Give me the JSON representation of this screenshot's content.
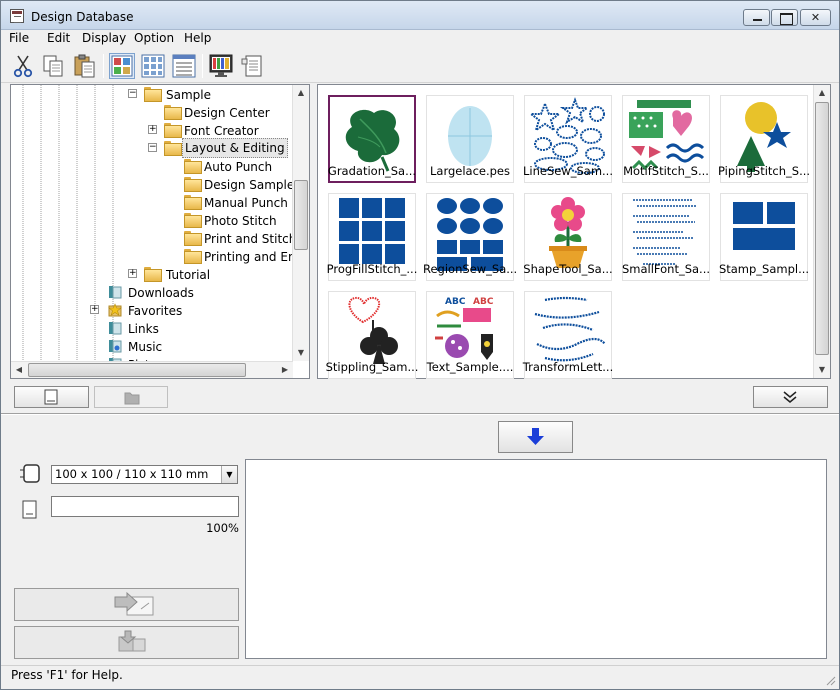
{
  "window": {
    "title": "Design Database"
  },
  "menu": [
    "File",
    "Edit",
    "Display",
    "Option",
    "Help"
  ],
  "toolbar": {
    "buttons": [
      "cut-icon",
      "copy-icon",
      "paste-icon",
      "large-thumbnails-icon",
      "small-thumbnails-icon",
      "details-view-icon",
      "preview-monitor-icon",
      "properties-icon"
    ]
  },
  "tree": {
    "items": [
      {
        "label": "Sample",
        "level": 0,
        "expanded": true
      },
      {
        "label": "Design Center",
        "level": 1
      },
      {
        "label": "Font Creator",
        "level": 1,
        "expandable": true
      },
      {
        "label": "Layout & Editing",
        "level": 1,
        "expanded": true,
        "selected": true
      },
      {
        "label": "Auto Punch",
        "level": 2
      },
      {
        "label": "Design Sample",
        "level": 2
      },
      {
        "label": "Manual Punch",
        "level": 2
      },
      {
        "label": "Photo Stitch",
        "level": 2
      },
      {
        "label": "Print and Stitch",
        "level": 2
      },
      {
        "label": "Printing and Emb",
        "level": 2
      },
      {
        "label": "Tutorial",
        "level": 0,
        "expandable": true
      },
      {
        "label": "Downloads",
        "level": -1
      },
      {
        "label": "Favorites",
        "level": -1,
        "expandable": true
      },
      {
        "label": "Links",
        "level": -1
      },
      {
        "label": "Music",
        "level": -1
      },
      {
        "label": "Pictures",
        "level": -1
      }
    ]
  },
  "files": [
    {
      "label": "Gradation_Sa...",
      "selected": true
    },
    {
      "label": "Largelace.pes"
    },
    {
      "label": "LineSew_Sam..."
    },
    {
      "label": "MotifStitch_S..."
    },
    {
      "label": "PipingStitch_S..."
    },
    {
      "label": "ProgFillStitch_..."
    },
    {
      "label": "RegionSew_Sa..."
    },
    {
      "label": "ShapeTool_Sa..."
    },
    {
      "label": "SmallFont_Sa..."
    },
    {
      "label": "Stamp_Sampl..."
    },
    {
      "label": "Stippling_Sam..."
    },
    {
      "label": "Text_Sample...."
    },
    {
      "label": "TransformLett..."
    }
  ],
  "hoop": {
    "selected": "100 x 100 / 110 x 110 mm"
  },
  "design_name": {
    "value": ""
  },
  "progress": {
    "text": "100%"
  },
  "status": {
    "text": "Press 'F1' for Help."
  },
  "colors": {
    "accent_blue": "#0d4e9c",
    "selection_border": "#6d1f5e",
    "leaf_green": "#1b6b3a"
  }
}
